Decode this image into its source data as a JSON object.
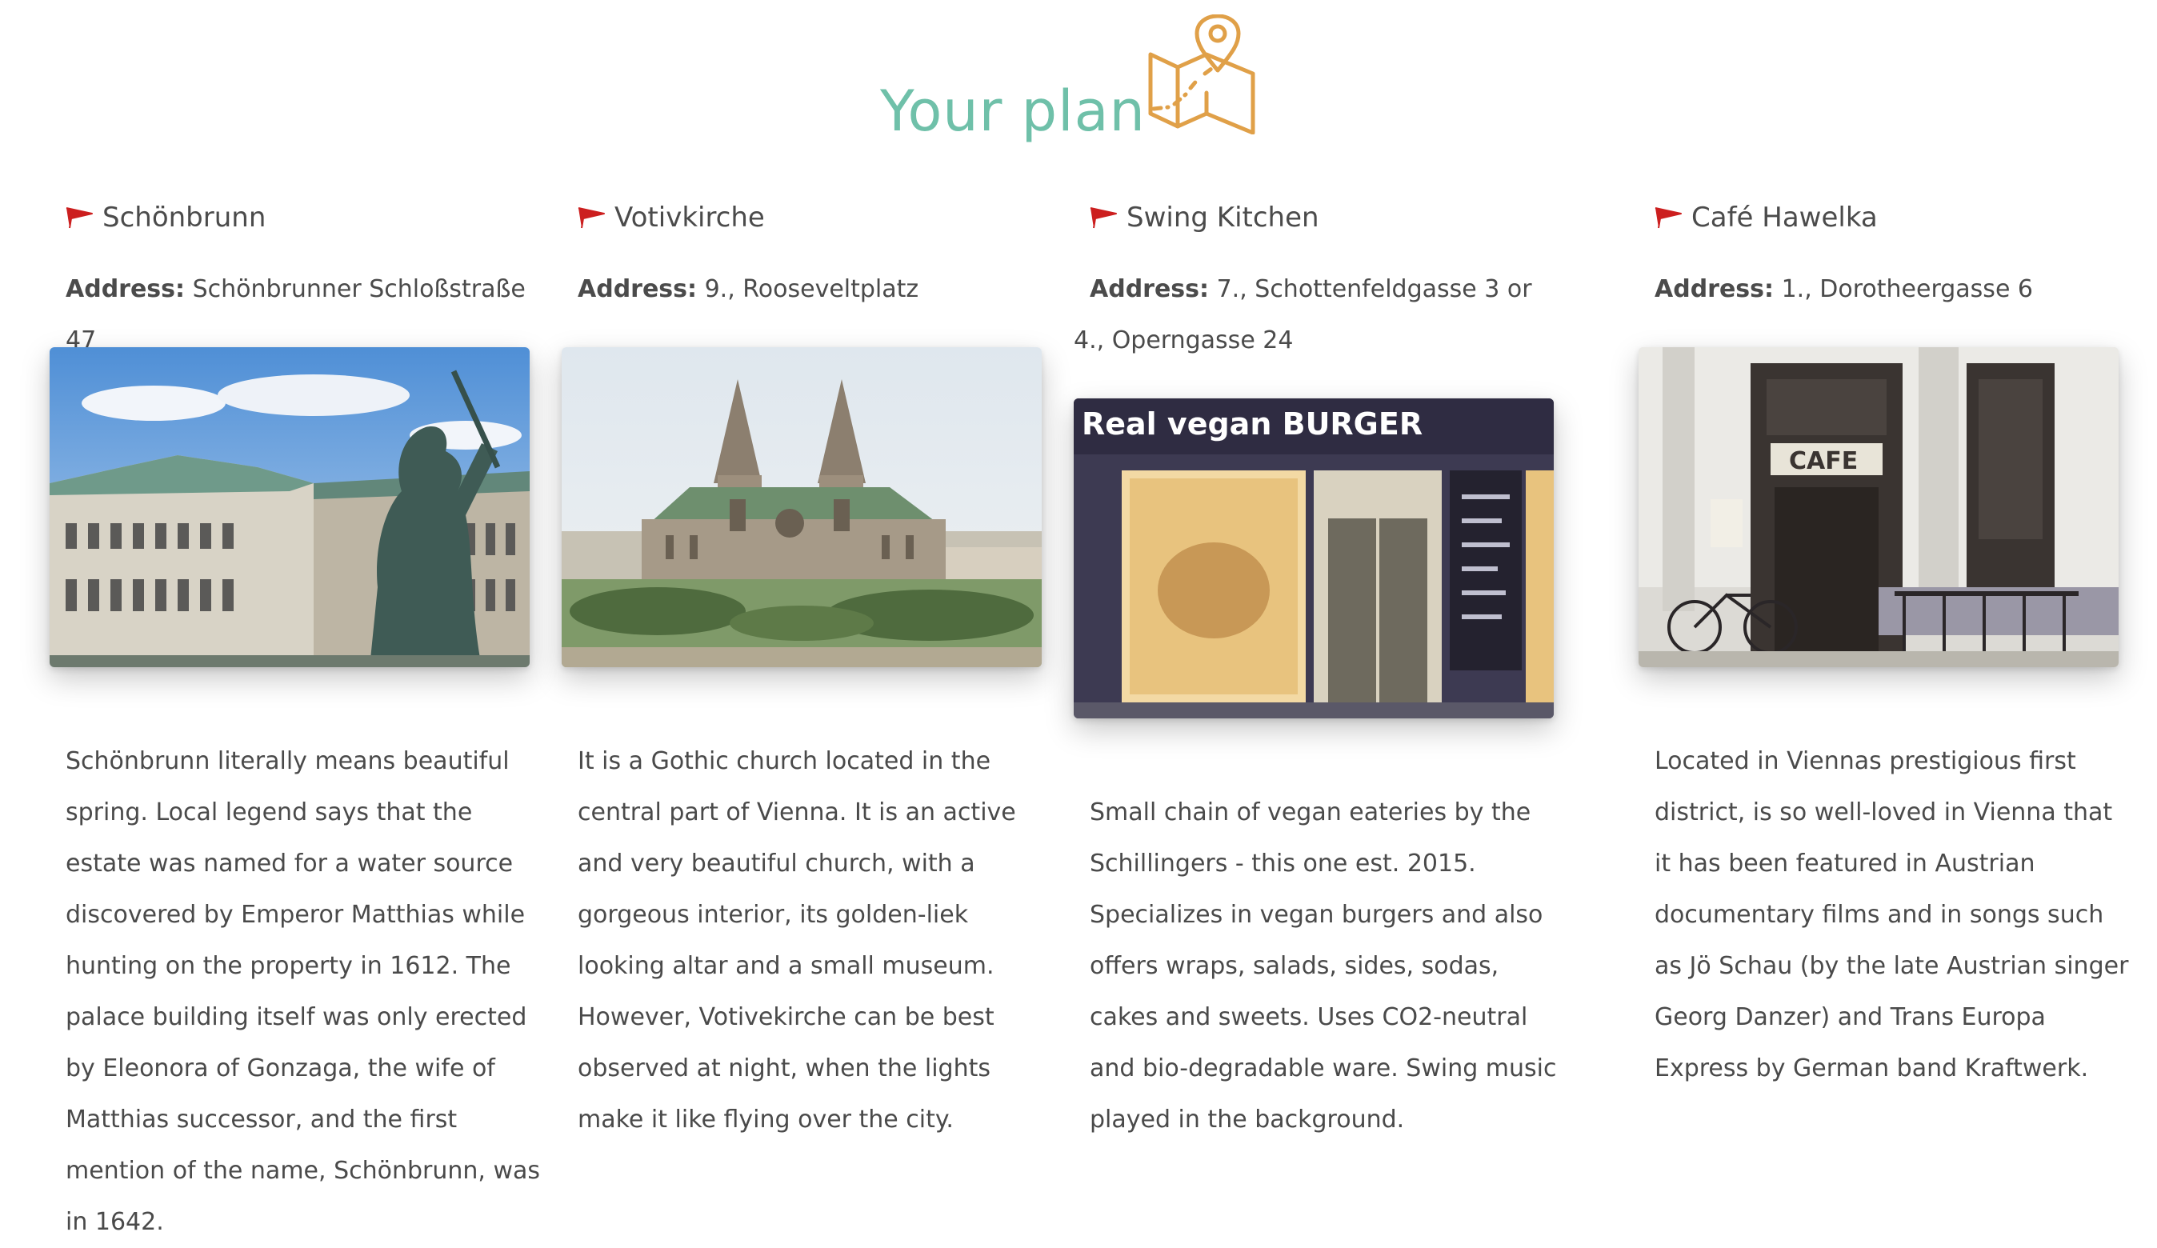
{
  "header": {
    "title": "Your plan",
    "icon": "map-pin-icon"
  },
  "places": [
    {
      "name": "Schönbrunn",
      "address_label": "Address:",
      "address": "Schönbrunner Schloßstraße 47",
      "image_alt": "Baroque palace with equestrian statue",
      "description": "Schönbrunn literally means beautiful spring. Local legend says that the estate was named for a water source discovered by Emperor Matthias while hunting on the property in 1612. The palace building itself was only erected by Eleonora of Gonzaga, the wife of Matthias successor, and the first mention of the name, Schönbrunn, was in 1642."
    },
    {
      "name": "Votivkirche",
      "address_label": "Address:",
      "address": "9., Rooseveltplatz",
      "image_alt": "Gothic church with twin spires",
      "description": "It is a Gothic church located in the central part of Vienna. It is an active and very beautiful church, with a gorgeous interior, its golden-liek looking altar and a small museum. However, Votivekirche can be best observed at night, when the lights make it like flying over the city."
    },
    {
      "name": "Swing Kitchen",
      "address_label": "Address:",
      "address": "7., Schottenfeldgasse 3 or 4., Operngasse 24",
      "image_alt": "Vegan burger restaurant storefront",
      "sign_text": "Real vegan BURGER",
      "description": "Small chain of vegan eateries by the Schillingers - this one est. 2015. Specializes in vegan burgers and also offers wraps, salads, sides, sodas, cakes and sweets. Uses CO2-neutral and bio-degradable ware. Swing music played in the background."
    },
    {
      "name": "Café Hawelka",
      "address_label": "Address:",
      "address": "1., Dorotheergasse 6",
      "image_alt": "Cafe facade with outdoor seating and bicycle",
      "sign_text": "CAFE",
      "description": "Located in Viennas prestigious first district, is so well-loved in Vienna that it has been featured in Austrian documentary films and in songs such as Jö Schau (by the late Austrian singer Georg Danzer) and Trans Europa Express by German band Kraftwerk."
    }
  ],
  "colors": {
    "title": "#6fc0a9",
    "icon": "#e0a048",
    "flag": "#cc1f1f"
  }
}
